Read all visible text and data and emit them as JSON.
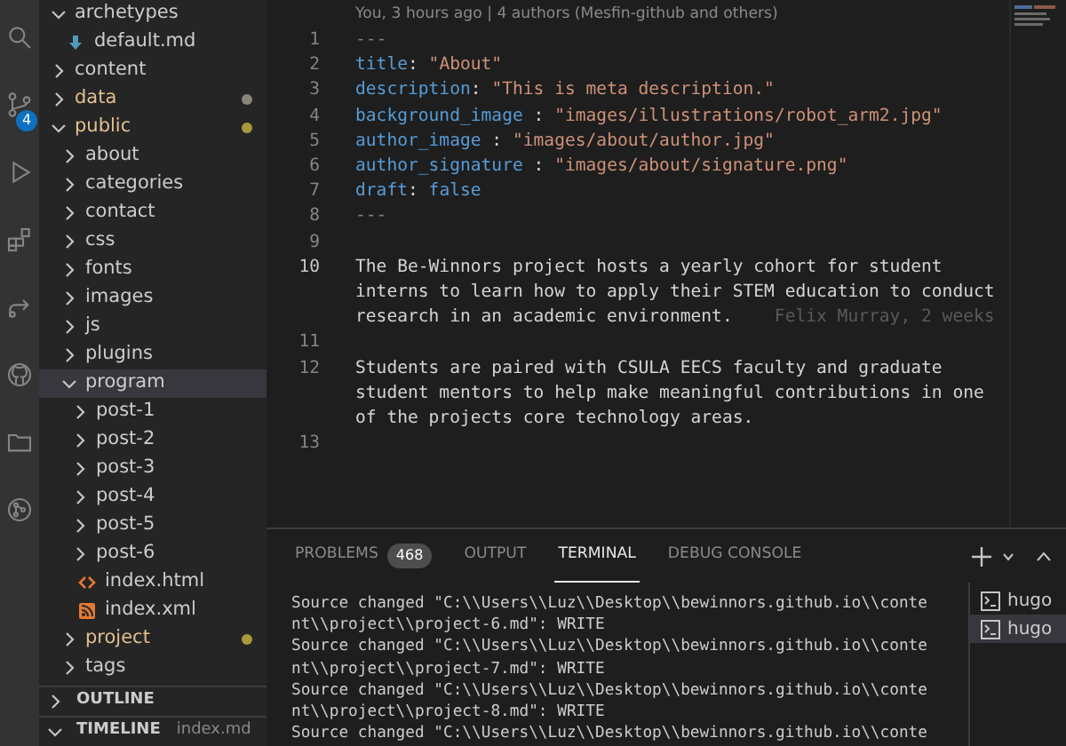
{
  "activity_bar": {
    "items": [
      {
        "kind": "search"
      },
      {
        "kind": "scm",
        "badge": "4"
      },
      {
        "kind": "run"
      },
      {
        "kind": "extensions"
      },
      {
        "kind": "share"
      },
      {
        "kind": "github"
      },
      {
        "kind": "folder"
      },
      {
        "kind": "graph"
      }
    ]
  },
  "explorer": {
    "tree": [
      {
        "label": "archetypes",
        "kind": "folder",
        "expanded": true,
        "selected": false,
        "children": [
          {
            "label": "default.md",
            "kind": "markdown",
            "selected": false
          }
        ]
      },
      {
        "label": "content",
        "kind": "folder",
        "expanded": false,
        "selected": false
      },
      {
        "label": "data",
        "kind": "folder",
        "expanded": false,
        "selected": false,
        "color": "#8a857a"
      },
      {
        "label": "public",
        "kind": "folder",
        "expanded": true,
        "selected": false,
        "color": "#a89a3c",
        "children": [
          {
            "label": "about",
            "kind": "folder",
            "expanded": false,
            "selected": false
          },
          {
            "label": "categories",
            "kind": "folder",
            "expanded": false,
            "selected": false
          },
          {
            "label": "contact",
            "kind": "folder",
            "expanded": false,
            "selected": false
          },
          {
            "label": "css",
            "kind": "folder",
            "expanded": false,
            "selected": false
          },
          {
            "label": "fonts",
            "kind": "folder",
            "expanded": false,
            "selected": false
          },
          {
            "label": "images",
            "kind": "folder",
            "expanded": false,
            "selected": false
          },
          {
            "label": "js",
            "kind": "folder",
            "expanded": false,
            "selected": false
          },
          {
            "label": "plugins",
            "kind": "folder",
            "expanded": false,
            "selected": false
          },
          {
            "label": "program",
            "kind": "folder",
            "expanded": true,
            "selected": true,
            "children": [
              {
                "label": "post-1",
                "kind": "folder",
                "expanded": false,
                "selected": false
              },
              {
                "label": "post-2",
                "kind": "folder",
                "expanded": false,
                "selected": false
              },
              {
                "label": "post-3",
                "kind": "folder",
                "expanded": false,
                "selected": false
              },
              {
                "label": "post-4",
                "kind": "folder",
                "expanded": false,
                "selected": false
              },
              {
                "label": "post-5",
                "kind": "folder",
                "expanded": false,
                "selected": false
              },
              {
                "label": "post-6",
                "kind": "folder",
                "expanded": false,
                "selected": false
              },
              {
                "label": "index.html",
                "kind": "html",
                "selected": false
              },
              {
                "label": "index.xml",
                "kind": "rss",
                "selected": false
              }
            ]
          },
          {
            "label": "project",
            "kind": "folder",
            "expanded": false,
            "selected": false,
            "color": "#a89a3c"
          },
          {
            "label": "tags",
            "kind": "folder",
            "expanded": false,
            "selected": false
          }
        ]
      }
    ],
    "sections": [
      {
        "title": "OUTLINE",
        "expanded": false
      },
      {
        "title": "TIMELINE",
        "expanded": true,
        "detail": "index.md"
      }
    ]
  },
  "editor": {
    "blame_header": "You, 3 hours ago | 4 authors (Mesfin-github and others)",
    "lines": [
      {
        "number": "1",
        "current": false,
        "tokens": [
          {
            "text": "---",
            "kind": "punct"
          }
        ]
      },
      {
        "number": "2",
        "current": false,
        "tokens": [
          {
            "text": "title",
            "kind": "key"
          },
          {
            "text": ": ",
            "kind": "text"
          },
          {
            "text": "\"About\"",
            "kind": "string"
          }
        ]
      },
      {
        "number": "3",
        "current": false,
        "tokens": [
          {
            "text": "description",
            "kind": "key"
          },
          {
            "text": ": ",
            "kind": "text"
          },
          {
            "text": "\"This is meta description.\"",
            "kind": "string"
          }
        ]
      },
      {
        "number": "4",
        "current": false,
        "tokens": [
          {
            "text": "background_image",
            "kind": "key"
          },
          {
            "text": " : ",
            "kind": "text"
          },
          {
            "text": "\"images/illustrations/robot_arm2.jpg\"",
            "kind": "string"
          }
        ]
      },
      {
        "number": "5",
        "current": false,
        "tokens": [
          {
            "text": "author_image",
            "kind": "key"
          },
          {
            "text": " : ",
            "kind": "text"
          },
          {
            "text": "\"images/about/author.jpg\"",
            "kind": "string"
          }
        ]
      },
      {
        "number": "6",
        "current": false,
        "tokens": [
          {
            "text": "author_signature",
            "kind": "key"
          },
          {
            "text": " : ",
            "kind": "text"
          },
          {
            "text": "\"images/about/signature.png\"",
            "kind": "string"
          }
        ]
      },
      {
        "number": "7",
        "current": false,
        "tokens": [
          {
            "text": "draft",
            "kind": "key"
          },
          {
            "text": ": ",
            "kind": "text"
          },
          {
            "text": "false",
            "kind": "bool"
          }
        ]
      },
      {
        "number": "8",
        "current": false,
        "tokens": [
          {
            "text": "---",
            "kind": "punct"
          }
        ]
      },
      {
        "number": "9",
        "current": false
      },
      {
        "number": "10",
        "current": true,
        "wrapped": [
          "The Be-Winnors project hosts a yearly cohort for student",
          "interns to learn how to apply their STEM education to conduct",
          "research in an academic environment."
        ],
        "blame": "Felix Murray, 2 weeks"
      },
      {
        "number": "11",
        "current": false
      },
      {
        "number": "12",
        "current": false,
        "wrapped": [
          "Students are paired with CSULA EECS faculty and graduate",
          "student mentors to help make meaningful contributions in one",
          "of the projects core technology areas."
        ]
      },
      {
        "number": "13",
        "current": false
      }
    ]
  },
  "panel": {
    "tabs": [
      {
        "label": "PROBLEMS",
        "count": "468",
        "selected": false
      },
      {
        "label": "OUTPUT",
        "selected": false
      },
      {
        "label": "TERMINAL",
        "selected": true
      },
      {
        "label": "DEBUG CONSOLE",
        "selected": false
      }
    ],
    "terminal_lines": [
      "Source changed \"C:\\\\Users\\\\Luz\\\\Desktop\\\\bewinnors.github.io\\\\content\\\\project\\\\project-6.md\": WRITE",
      "Source changed \"C:\\\\Users\\\\Luz\\\\Desktop\\\\bewinnors.github.io\\\\content\\\\project\\\\project-7.md\": WRITE",
      "Source changed \"C:\\\\Users\\\\Luz\\\\Desktop\\\\bewinnors.github.io\\\\content\\\\project\\\\project-8.md\": WRITE",
      "Source changed \"C:\\\\Users\\\\Luz\\\\Desktop\\\\bewinnors.github.io\\\\conte"
    ],
    "terminals": [
      {
        "label": "hugo",
        "selected": false
      },
      {
        "label": "hugo",
        "selected": true
      }
    ]
  }
}
